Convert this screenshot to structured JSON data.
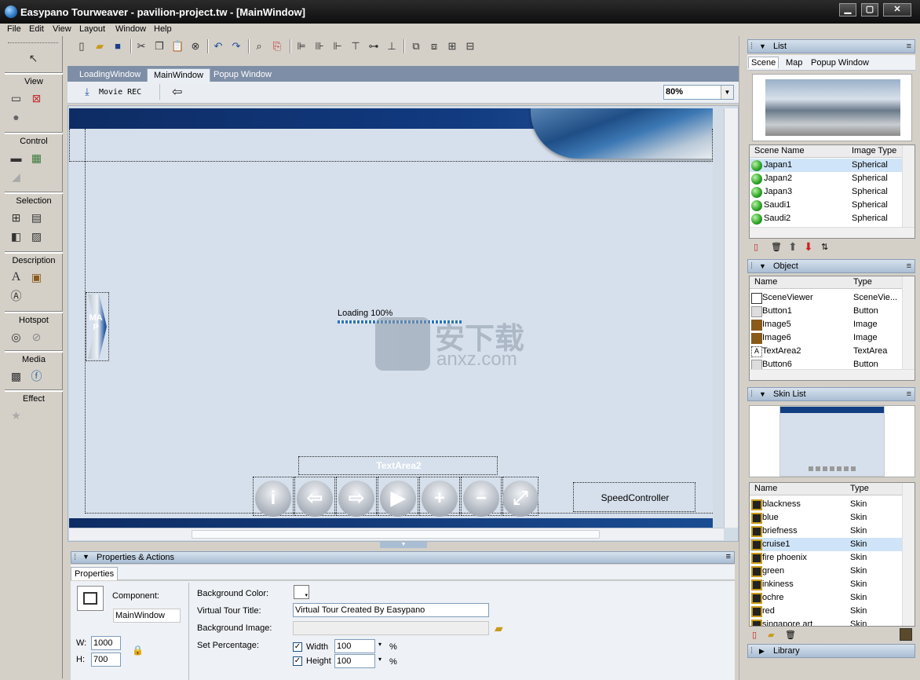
{
  "window": {
    "title": "Easypano Tourweaver - pavilion-project.tw - [MainWindow]",
    "min_glyph": "▁",
    "max_glyph": "▢",
    "close_glyph": "✕"
  },
  "menu": [
    "File",
    "Edit",
    "View",
    "Layout",
    "Window",
    "Help"
  ],
  "toolbox": {
    "groups": [
      {
        "label": "View"
      },
      {
        "label": "Control"
      },
      {
        "label": "Selection"
      },
      {
        "label": "Description"
      },
      {
        "label": "Hotspot"
      },
      {
        "label": "Media"
      },
      {
        "label": "Effect"
      }
    ]
  },
  "doc_tabs": [
    "LoadingWindow",
    "MainWindow",
    "Popup Window"
  ],
  "editor_toolbar": {
    "movie_rec": "Movie REC",
    "back_arrow": "⇦",
    "zoom": "80%"
  },
  "stage": {
    "map_text": "MAP",
    "loading_text": "Loading 100%",
    "textarea_label": "TextArea2",
    "speed_controller": "SpeedController",
    "control_glyphs": [
      "i",
      "⇦",
      "⇨",
      "▶",
      "+",
      "−",
      "⤢"
    ]
  },
  "properties": {
    "header": "Properties & Actions",
    "tab": "Properties",
    "component_label": "Component:",
    "component_value": "MainWindow",
    "w_label": "W:",
    "w_value": "1000",
    "h_label": "H:",
    "h_value": "700",
    "bg_color_label": "Background Color:",
    "title_label": "Virtual Tour Title:",
    "title_value": "Virtual Tour Created By Easypano",
    "bg_image_label": "Background Image:",
    "set_pct_label": "Set Percentage:",
    "width_label": "Width",
    "width_value": "100",
    "height_label": "Height",
    "height_value": "100",
    "pct": "%"
  },
  "right": {
    "list_header": "List",
    "list_tabs": [
      "Scene",
      "Map",
      "Popup Window"
    ],
    "scene_cols": [
      "Scene Name",
      "Image Type"
    ],
    "scenes": [
      {
        "name": "Japan1",
        "type": "Spherical"
      },
      {
        "name": "Japan2",
        "type": "Spherical"
      },
      {
        "name": "Japan3",
        "type": "Spherical"
      },
      {
        "name": "Saudi1",
        "type": "Spherical"
      },
      {
        "name": "Saudi2",
        "type": "Spherical"
      }
    ],
    "object_header": "Object",
    "object_cols": [
      "Name",
      "Type"
    ],
    "objects": [
      {
        "name": "SceneViewer",
        "type": "SceneVie..."
      },
      {
        "name": "Button1",
        "type": "Button"
      },
      {
        "name": "Image5",
        "type": "Image"
      },
      {
        "name": "Image6",
        "type": "Image"
      },
      {
        "name": "TextArea2",
        "type": "TextArea"
      },
      {
        "name": "Button6",
        "type": "Button"
      }
    ],
    "skin_header": "Skin List",
    "skin_cols": [
      "Name",
      "Type"
    ],
    "skins": [
      {
        "name": "blackness",
        "type": "Skin"
      },
      {
        "name": "blue",
        "type": "Skin"
      },
      {
        "name": "briefness",
        "type": "Skin"
      },
      {
        "name": "cruise1",
        "type": "Skin"
      },
      {
        "name": "fire phoenix",
        "type": "Skin"
      },
      {
        "name": "green",
        "type": "Skin"
      },
      {
        "name": "inkiness",
        "type": "Skin"
      },
      {
        "name": "ochre",
        "type": "Skin"
      },
      {
        "name": "red",
        "type": "Skin"
      },
      {
        "name": "singapore art",
        "type": "Skin"
      }
    ],
    "library_header": "Library"
  },
  "watermark": {
    "cn": "安下载",
    "en": "anxz.com"
  },
  "colors": {
    "accent": "#2a74c0",
    "tab_bar": "#7e8ea6",
    "stage_bg": "#d6e0ec"
  }
}
